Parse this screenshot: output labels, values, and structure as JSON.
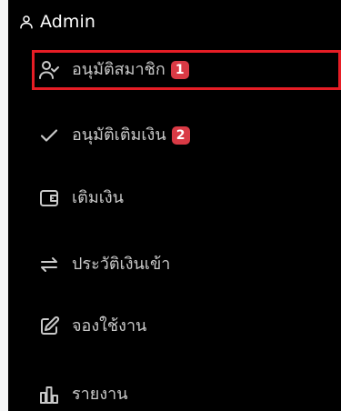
{
  "header": {
    "title": "Admin",
    "icon": "user-icon"
  },
  "menu": [
    {
      "label": "อนุมัติสมาชิก",
      "badge": "1",
      "icon": "user-check-icon",
      "highlighted": true
    },
    {
      "label": "อนุมัติเติมเงิน",
      "badge": "2",
      "icon": "check-icon"
    },
    {
      "label": "เติมเงิน",
      "icon": "wallet-icon"
    },
    {
      "label": "ประวัติเงินเข้า",
      "icon": "arrows-left-right-icon"
    },
    {
      "label": "จองใช้งาน",
      "icon": "edit-icon"
    },
    {
      "label": "รายงาน",
      "icon": "bar-chart-icon"
    }
  ],
  "colors": {
    "background": "#000000",
    "text": "#c9c9c9",
    "header_text": "#ffffff",
    "badge": "#d93a45",
    "highlight_border": "#e61d25"
  }
}
